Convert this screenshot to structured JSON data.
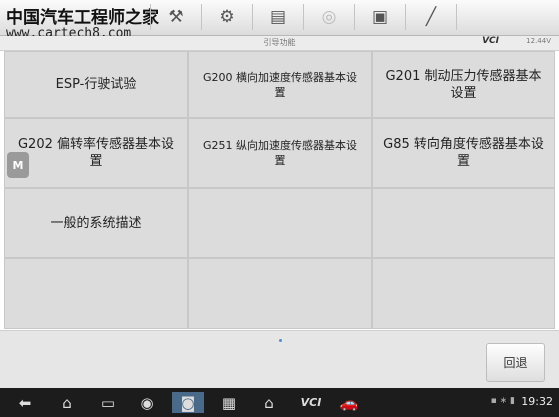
{
  "watermark": {
    "line1": "中国汽车工程师之家",
    "line2": "www.cartech8.com"
  },
  "toolbar": {
    "icons": [
      "car-icon",
      "gear-icon",
      "printer-icon",
      "help-icon",
      "save-icon",
      "edit-icon"
    ]
  },
  "title": "引导功能",
  "status": {
    "vci": "VCI",
    "battery": "12.44V"
  },
  "functions": [
    "ESP-行驶试验",
    "G200 横向加速度传感器基本设置",
    "G201 制动压力传感器基本设置",
    "G202 偏转率传感器基本设置",
    "G251 纵向加速度传感器基本设置",
    "G85 转向角度传感器基本设置",
    "一般的系统描述"
  ],
  "side_badge": "M",
  "back_label": "回退",
  "navbar": {
    "vci": "VCI",
    "time": "19:32"
  }
}
